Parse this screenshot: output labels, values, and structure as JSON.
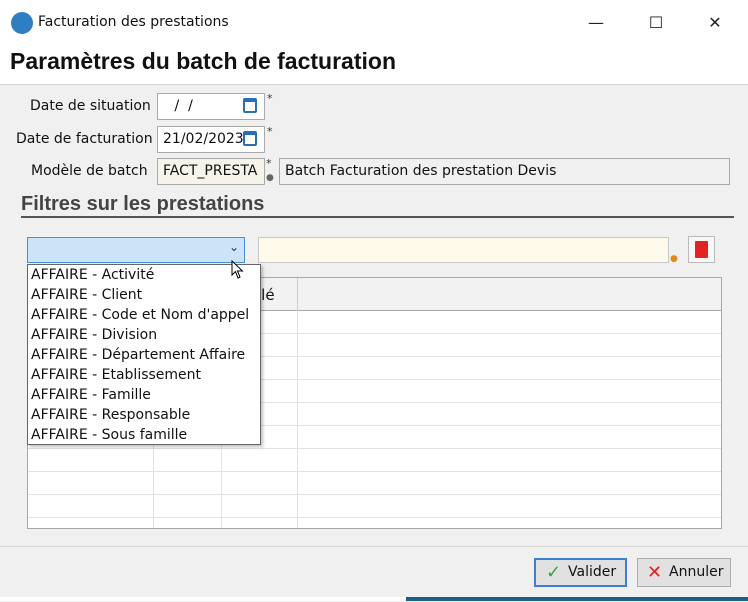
{
  "window": {
    "title": "Facturation des prestations"
  },
  "heading": "Paramètres du batch de facturation",
  "form": {
    "date_situation": {
      "label": "Date de situation",
      "value": " /  /"
    },
    "date_facturation": {
      "label": "Date de facturation",
      "value": "21/02/2023"
    },
    "modele_batch": {
      "label": "Modèle de batch",
      "code": "FACT_PRESTA",
      "description": "Batch Facturation des prestation Devis"
    },
    "required_mark": "*"
  },
  "filters": {
    "title": "Filtres sur les prestations",
    "combo_value": "",
    "filter_value": "",
    "dropdown_options": [
      "AFFAIRE - Activité",
      "AFFAIRE - Client",
      "AFFAIRE - Code et Nom d'appel",
      "AFFAIRE - Division",
      "AFFAIRE - Département Affaire",
      "AFFAIRE - Etablissement",
      "AFFAIRE - Famille",
      "AFFAIRE - Responsable",
      "AFFAIRE - Sous famille"
    ],
    "grid_visible_header": "llé"
  },
  "footer": {
    "validate": "Valider",
    "cancel": "Annuler"
  },
  "icons": {
    "app": "app-logo-icon",
    "calendar": "calendar-icon",
    "delete": "trash-icon",
    "validate": "check-icon",
    "cancel": "cross-icon"
  },
  "colors": {
    "accent": "#2d7fc2",
    "selection": "#cce4f7",
    "delete": "#e02424",
    "check": "#3aa43a"
  }
}
